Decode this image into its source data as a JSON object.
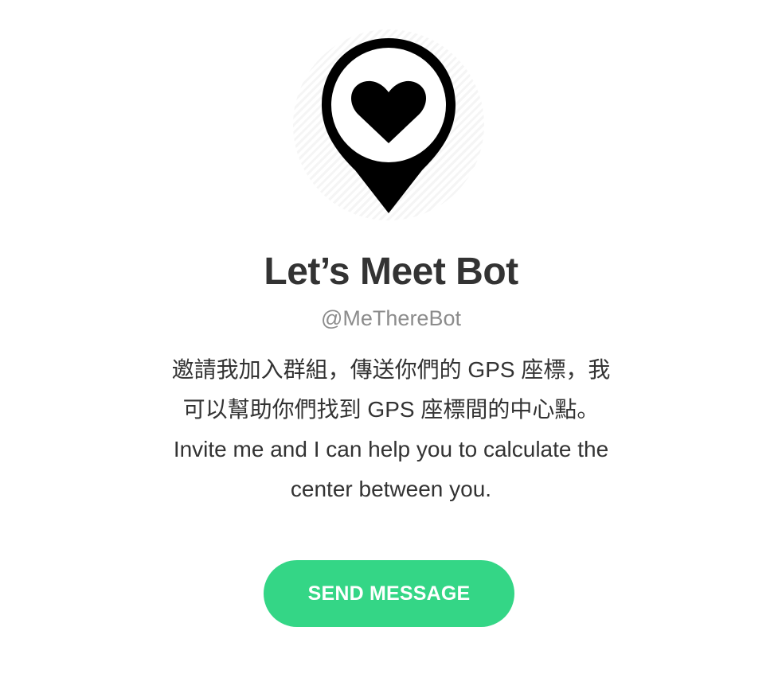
{
  "profile": {
    "avatar_icon": "map-pin-heart-icon",
    "name": "Let’s Meet Bot",
    "handle": "@MeThereBot",
    "description_lines": [
      "邀請我加入群組，傳送你們的 GPS 座標，我",
      "可以幫助你們找到 GPS 座標間的中心點。",
      "Invite me and I can help you to calculate the",
      "center between you."
    ]
  },
  "actions": {
    "send_message_label": "SEND MESSAGE"
  },
  "colors": {
    "accent": "#34d686",
    "title": "#333333",
    "handle": "#8c8c8c",
    "icon": "#000000"
  }
}
